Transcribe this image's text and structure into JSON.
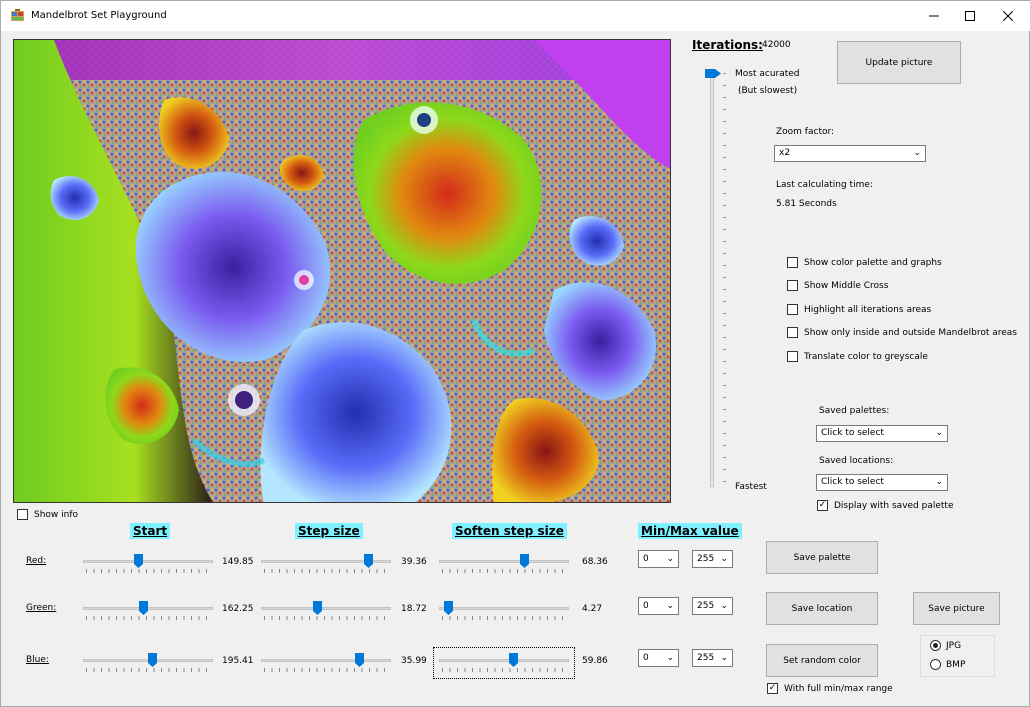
{
  "window": {
    "title": "Mandelbrot Set Playground"
  },
  "iterations": {
    "label": "Iterations:",
    "value": "42000",
    "top_label": "Most acurated",
    "top_sub": "(But slowest)",
    "bottom_label": "Fastest"
  },
  "update_button": "Update picture",
  "zoom": {
    "label": "Zoom factor:",
    "value": "x2"
  },
  "calc_time": {
    "label": "Last calculating time:",
    "value": "5.81 Seconds"
  },
  "options": [
    {
      "label": "Show color palette and graphs",
      "checked": false
    },
    {
      "label": "Show Middle Cross",
      "checked": false
    },
    {
      "label": "Highlight all iterations areas",
      "checked": false
    },
    {
      "label": "Show only inside and outside Mandelbrot areas",
      "checked": false
    },
    {
      "label": "Translate color to greyscale",
      "checked": false
    }
  ],
  "saved_palettes": {
    "label": "Saved palettes:",
    "value": "Click to select"
  },
  "saved_locations": {
    "label": "Saved locations:",
    "value": "Click to select"
  },
  "display_saved_palette": {
    "label": "Display with saved palette",
    "checked": true
  },
  "show_info": {
    "label": "Show info",
    "checked": false
  },
  "columns": {
    "start": "Start",
    "step": "Step size",
    "soften": "Soften step size",
    "minmax": "Min/Max value"
  },
  "rows": [
    {
      "label": "Red:",
      "start": "149.85",
      "step": "39.36",
      "soften": "68.36",
      "min": "0",
      "max": "255",
      "start_level": 0.42,
      "step_level": 0.85,
      "soften_level": 0.67
    },
    {
      "label": "Green:",
      "start": "162.25",
      "step": "18.72",
      "soften": "4.27",
      "min": "0",
      "max": "255",
      "start_level": 0.46,
      "step_level": 0.43,
      "soften_level": 0.04
    },
    {
      "label": "Blue:",
      "start": "195.41",
      "step": "35.99",
      "soften": "59.86",
      "min": "0",
      "max": "255",
      "start_level": 0.54,
      "step_level": 0.78,
      "soften_level": 0.58
    }
  ],
  "buttons": {
    "save_palette": "Save  palette",
    "save_location": "Save location",
    "save_picture": "Save picture",
    "random_color": "Set random color"
  },
  "full_range": {
    "label": "With full min/max range",
    "checked": true
  },
  "format": {
    "options": [
      "JPG",
      "BMP"
    ],
    "selected": "JPG"
  },
  "iteration_slider_level": 1.0,
  "colors": {
    "accent": "#0078d7",
    "header_bg": "#7ff0ff"
  }
}
